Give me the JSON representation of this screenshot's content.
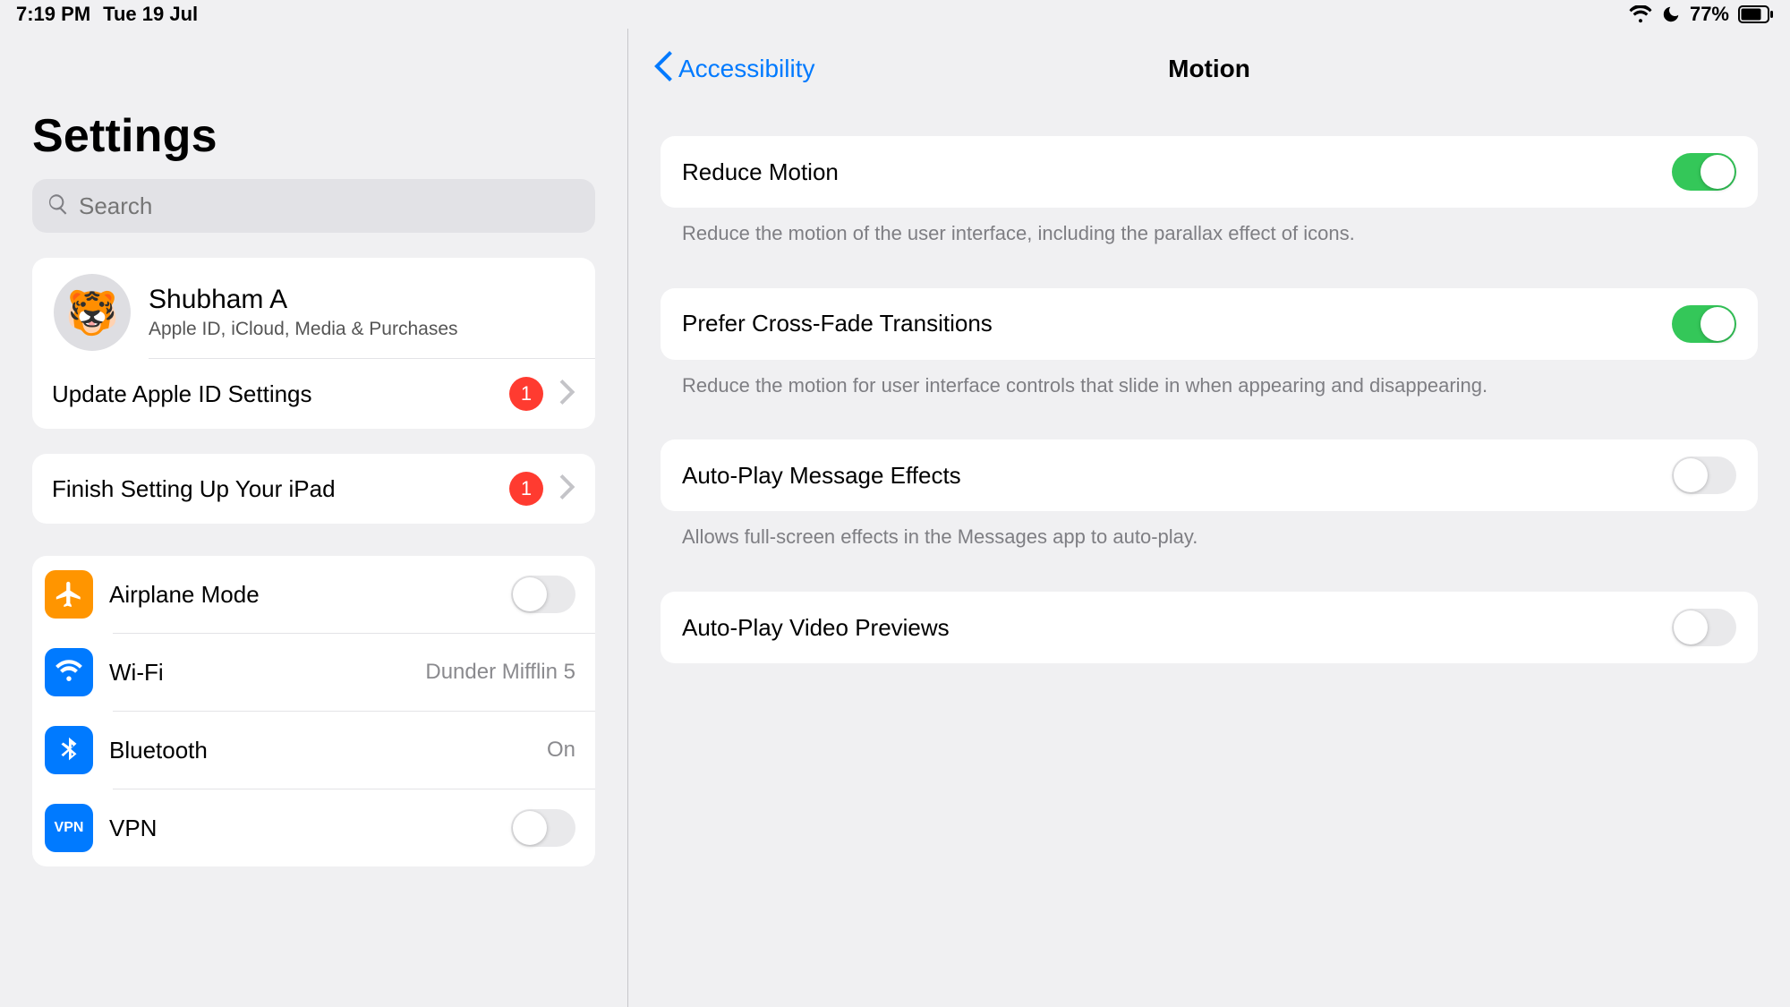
{
  "status": {
    "time": "7:19 PM",
    "date": "Tue 19 Jul",
    "battery_percent": "77%"
  },
  "sidebar": {
    "title": "Settings",
    "search_placeholder": "Search",
    "account": {
      "avatar_emoji": "🐯",
      "name": "Shubham A",
      "subtitle": "Apple ID, iCloud, Media & Purchases"
    },
    "update_apple_id": {
      "label": "Update Apple ID Settings",
      "badge": "1"
    },
    "finish_setup": {
      "label": "Finish Setting Up Your iPad",
      "badge": "1"
    },
    "network": {
      "airplane": {
        "label": "Airplane Mode",
        "on": false
      },
      "wifi": {
        "label": "Wi-Fi",
        "value": "Dunder Mifflin 5"
      },
      "bluetooth": {
        "label": "Bluetooth",
        "value": "On"
      },
      "vpn_label": "VPN",
      "vpn": {
        "label": "VPN",
        "on": false
      }
    }
  },
  "detail": {
    "back_label": "Accessibility",
    "title": "Motion",
    "rows": [
      {
        "label": "Reduce Motion",
        "on": true,
        "footer": "Reduce the motion of the user interface, including the parallax effect of icons."
      },
      {
        "label": "Prefer Cross-Fade Transitions",
        "on": true,
        "footer": "Reduce the motion for user interface controls that slide in when appearing and disappearing."
      },
      {
        "label": "Auto-Play Message Effects",
        "on": false,
        "footer": "Allows full-screen effects in the Messages app to auto-play."
      },
      {
        "label": "Auto-Play Video Previews",
        "on": false,
        "footer": ""
      }
    ]
  }
}
